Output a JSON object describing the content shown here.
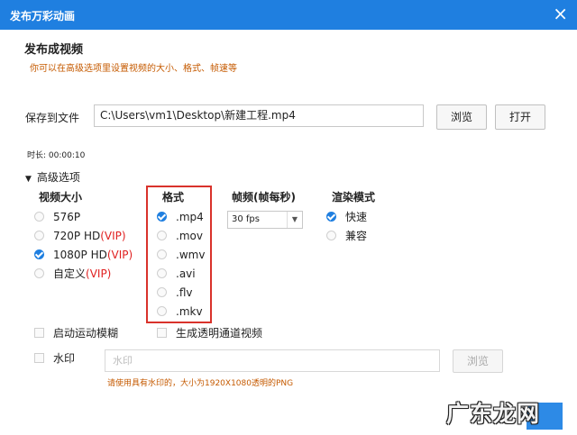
{
  "window": {
    "title": "发布万彩动画",
    "close_glyph": "×"
  },
  "header": {
    "heading": "发布成视频",
    "hint": "你可以在高级选项里设置视频的大小、格式、帧速等"
  },
  "save": {
    "label": "保存到文件",
    "path": "C:\\Users\\vm1\\Desktop\\新建工程.mp4",
    "browse_label": "浏览",
    "open_label": "打开"
  },
  "duration": "时长: 00:00:10",
  "advanced": {
    "label": "高级选项"
  },
  "size": {
    "title": "视频大小",
    "options": [
      {
        "label": "576P",
        "vip": "",
        "selected": false
      },
      {
        "label": "720P HD",
        "vip": "(VIP)",
        "selected": false
      },
      {
        "label": "1080P HD",
        "vip": "(VIP)",
        "selected": true
      },
      {
        "label": "自定义",
        "vip": "(VIP)",
        "selected": false
      }
    ]
  },
  "format": {
    "title": "格式",
    "options": [
      {
        "label": ".mp4",
        "selected": true
      },
      {
        "label": ".mov",
        "selected": false
      },
      {
        "label": ".wmv",
        "selected": false
      },
      {
        "label": ".avi",
        "selected": false
      },
      {
        "label": ".flv",
        "selected": false
      },
      {
        "label": ".mkv",
        "selected": false
      }
    ]
  },
  "fps": {
    "title": "帧频(帧每秒)",
    "value": "30 fps"
  },
  "render": {
    "title": "渲染模式",
    "options": [
      {
        "label": "快速",
        "selected": true
      },
      {
        "label": "兼容",
        "selected": false
      }
    ]
  },
  "checkboxes": {
    "motion_blur": "启动运动模糊",
    "alpha_video": "生成透明通道视频",
    "watermark": "水印"
  },
  "watermark": {
    "placeholder": "水印",
    "browse_label": "浏览",
    "hint": "请使用具有水印的，大小为1920X1080透明的PNG"
  },
  "overlay_logo": "广东龙网",
  "colors": {
    "titlebar": "#1f7fe0",
    "hint": "#c55a00",
    "vip": "#e02020",
    "highlight_box": "#d9322b",
    "accent": "#1f7fe0"
  }
}
